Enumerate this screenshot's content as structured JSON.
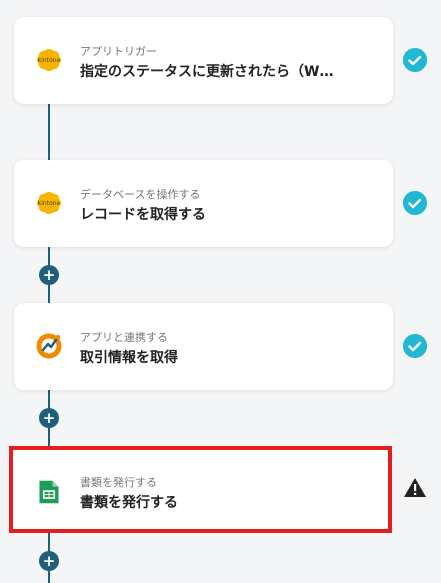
{
  "steps": [
    {
      "subtitle": "アプリトリガー",
      "title": "指定のステータスに更新されたら（W…",
      "app_icon": "kintone-icon",
      "status": "complete"
    },
    {
      "subtitle": "データベースを操作する",
      "title": "レコードを取得する",
      "app_icon": "kintone-icon",
      "status": "complete"
    },
    {
      "subtitle": "アプリと連携する",
      "title": "取引情報を取得",
      "app_icon": "freee-icon",
      "status": "complete"
    },
    {
      "subtitle": "書類を発行する",
      "title": "書類を発行する",
      "app_icon": "google-sheets-icon",
      "status": "warning"
    }
  ],
  "add_step_symbol": "+",
  "icons": {
    "kintone_text": "kintone"
  },
  "colors": {
    "connector": "#1f5f77",
    "check": "#22b8d4",
    "highlight": "#e21f1f",
    "kintone": "#f6b600",
    "freee": "#f08a00",
    "sheets": "#1e9d58"
  }
}
